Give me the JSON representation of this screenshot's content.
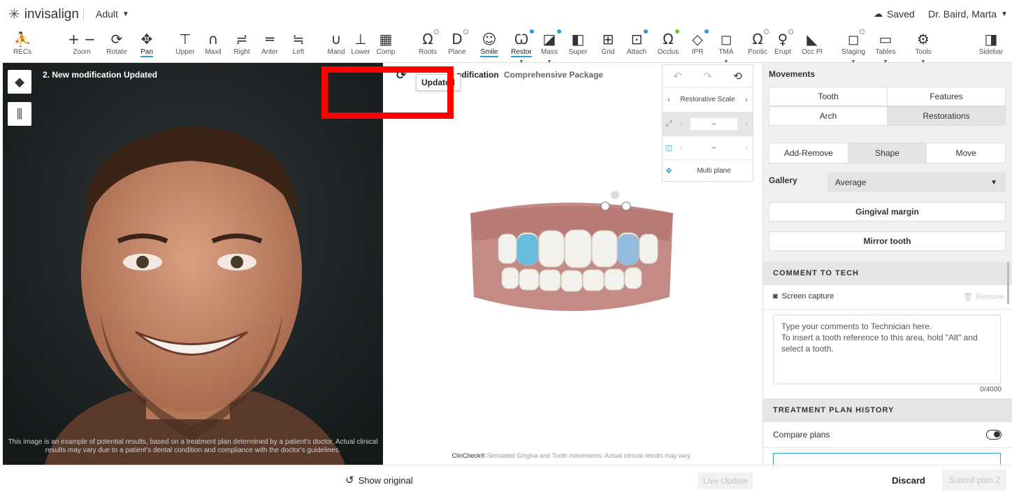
{
  "topbar": {
    "brand": "invisalign",
    "mode": "Adult",
    "saved": "Saved",
    "user": "Dr. Baird, Marta"
  },
  "toolbar": {
    "tools": [
      {
        "label": "RECs",
        "icon": "person-icon"
      },
      {
        "label": "Zoom",
        "icon": "zoom-icon"
      },
      {
        "label": "Rotate",
        "icon": "rotate-icon"
      },
      {
        "label": "Pan",
        "icon": "pan-icon",
        "active": true
      },
      {
        "label": "Upper",
        "icon": "upper-icon"
      },
      {
        "label": "Maxil",
        "icon": "maxil-icon"
      },
      {
        "label": "Right",
        "icon": "right-icon"
      },
      {
        "label": "Anter",
        "icon": "anter-icon"
      },
      {
        "label": "Left",
        "icon": "left-icon"
      },
      {
        "label": "Mand",
        "icon": "mand-icon"
      },
      {
        "label": "Lower",
        "icon": "lower-icon"
      },
      {
        "label": "Comp",
        "icon": "comp-icon"
      },
      {
        "label": "Roots",
        "icon": "roots-icon"
      },
      {
        "label": "Plane",
        "icon": "plane-icon"
      },
      {
        "label": "Smile",
        "icon": "smile-icon",
        "active": true
      },
      {
        "label": "Restor",
        "icon": "restor-icon",
        "active": true
      },
      {
        "label": "Mass",
        "icon": "mass-icon"
      },
      {
        "label": "Super",
        "icon": "super-icon"
      },
      {
        "label": "Grid",
        "icon": "grid-icon"
      },
      {
        "label": "Attach",
        "icon": "attach-icon"
      },
      {
        "label": "Occlus",
        "icon": "occlus-icon"
      },
      {
        "label": "IPR",
        "icon": "ipr-icon"
      },
      {
        "label": "TMA",
        "icon": "tma-icon"
      },
      {
        "label": "Pontic",
        "icon": "pontic-icon"
      },
      {
        "label": "Erupt",
        "icon": "erupt-icon"
      },
      {
        "label": "Occ Pl",
        "icon": "occ-pl-icon"
      },
      {
        "label": "Staging",
        "icon": "staging-icon"
      },
      {
        "label": "Tables",
        "icon": "tables-icon"
      },
      {
        "label": "Tools",
        "icon": "tools-icon"
      },
      {
        "label": "Sidebar",
        "icon": "sidebar-icon"
      }
    ]
  },
  "photo": {
    "title": "2. New modification  Updated",
    "disclaimer": "This image is an example of potential results, based on a treatment plan determined by a patient's doctor. Actual clinical results may vary due to a patient's dental condition and compliance with the doctor's guidelines."
  },
  "model": {
    "title": "odification",
    "package": "Comprehensive Package",
    "tooltip": "Updated",
    "caption_brand": "ClinCheck®",
    "caption": " Simulated Gingiva and Tooth movements. Actual clinical results may vary."
  },
  "restorative": {
    "scale_label": "Restorative Scale",
    "value1": "–",
    "value2": "–",
    "multi_plane": "Multi plane"
  },
  "sidebar": {
    "movements": "Movements",
    "tab_tooth": "Tooth",
    "tab_features": "Features",
    "tab_arch": "Arch",
    "tab_restorations": "Restorations",
    "seg_add_remove": "Add-Remove",
    "seg_shape": "Shape",
    "seg_move": "Move",
    "gallery_label": "Gallery",
    "gallery_value": "Average",
    "gingival_margin": "Gingival margin",
    "mirror_tooth": "Mirror tooth",
    "comment_header": "COMMENT TO TECH",
    "screen_capture": "Screen capture",
    "remove": "Remove",
    "comment_placeholder": "Type your comments to Technician here.\nTo insert a tooth reference to this area, hold \"Alt\" and select a tooth.",
    "counter": "0/4000",
    "history_header": "TREATMENT PLAN HISTORY",
    "compare_plans": "Compare plans"
  },
  "bottom": {
    "show_original": "Show original",
    "live_update": "Live Update",
    "discard": "Discard",
    "submit": "Submit plan 2"
  }
}
